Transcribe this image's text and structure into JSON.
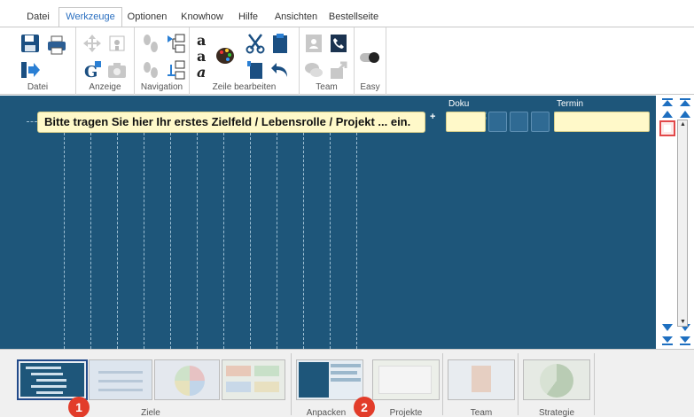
{
  "menu": {
    "tabs": [
      "Datei",
      "Werkzeuge",
      "Optionen",
      "Knowhow",
      "Hilfe",
      "Ansichten",
      "Bestellseite"
    ],
    "active": "Werkzeuge"
  },
  "ribbon": {
    "groups": [
      "Datei",
      "Anzeige",
      "Navigation",
      "Zeile bearbeiten",
      "Team",
      "Easy"
    ]
  },
  "main": {
    "columns": {
      "doku": "Doku",
      "termin": "Termin"
    },
    "goal_placeholder": "Bitte tragen Sie hier Ihr erstes Zielfeld / Lebensrolle / Projekt ... ein.",
    "add_symbol": "+"
  },
  "bottom": {
    "labels": [
      "Ziele",
      "Anpacken",
      "Projekte",
      "Team",
      "Strategie"
    ],
    "badges": [
      "1",
      "2"
    ]
  },
  "colors": {
    "main_bg": "#1e567a",
    "active_tab": "#2a6fc0",
    "field_bg": "#fff9c9",
    "badge": "#e23c2a"
  },
  "icons": [
    "save-icon",
    "print-icon",
    "exit-icon",
    "move-icon",
    "zoom-icon",
    "google-icon",
    "camera-icon",
    "footsteps-icon",
    "tree-icon",
    "text-style-icon",
    "palette-icon",
    "cut-icon",
    "paste-icon",
    "copy-icon",
    "undo-icon",
    "contacts-icon",
    "phone-icon",
    "chat-icon",
    "share-icon",
    "toggle-icon"
  ]
}
